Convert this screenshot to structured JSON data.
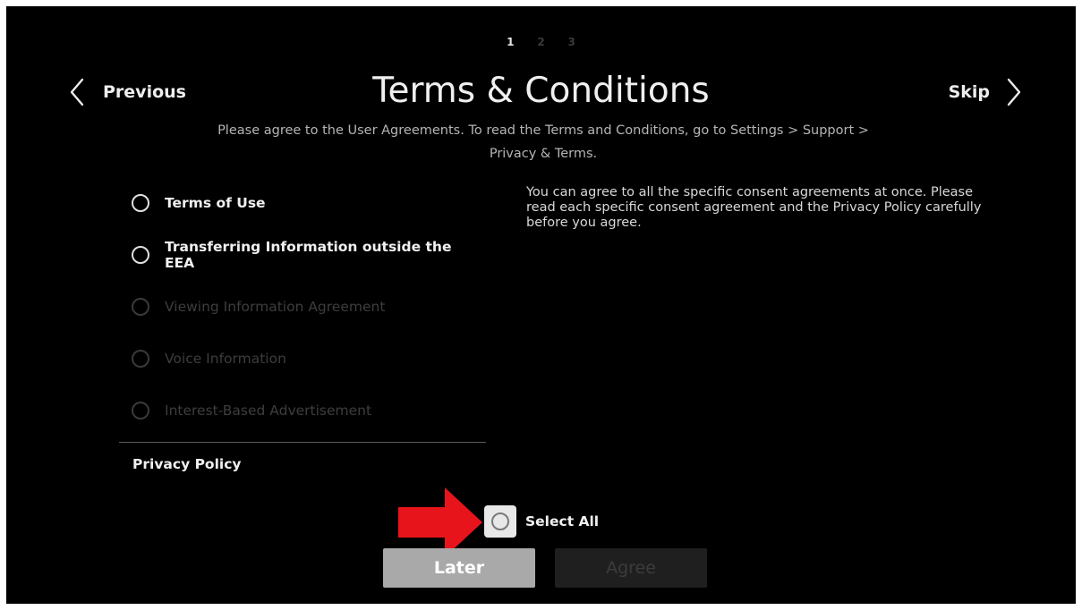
{
  "steps": [
    "1",
    "2",
    "3"
  ],
  "header": {
    "previous_label": "Previous",
    "skip_label": "Skip",
    "title": "Terms & Conditions",
    "subtitle": "Please agree to the User Agreements. To read the Terms and Conditions, go to Settings > Support > Privacy & Terms."
  },
  "agreements": [
    {
      "label": "Terms of Use",
      "enabled": true,
      "checked": false
    },
    {
      "label": "Transferring Information outside the EEA",
      "enabled": true,
      "checked": false
    },
    {
      "label": "Viewing Information Agreement",
      "enabled": false,
      "checked": false
    },
    {
      "label": "Voice Information",
      "enabled": false,
      "checked": false
    },
    {
      "label": "Interest-Based Advertisement",
      "enabled": false,
      "checked": false
    }
  ],
  "privacy_policy_label": "Privacy Policy",
  "info_text": "You can agree to all the specific consent agreements at once. Please read each specific consent agreement and the Privacy Policy carefully before you agree.",
  "select_all": {
    "label": "Select All",
    "checked": false,
    "focused": true
  },
  "buttons": {
    "later": "Later",
    "agree": "Agree"
  },
  "colors": {
    "background": "#000000",
    "focus_button": "#a9a9a9",
    "disabled_button": "#1f1f1f",
    "annotation_arrow": "#e8141b"
  }
}
